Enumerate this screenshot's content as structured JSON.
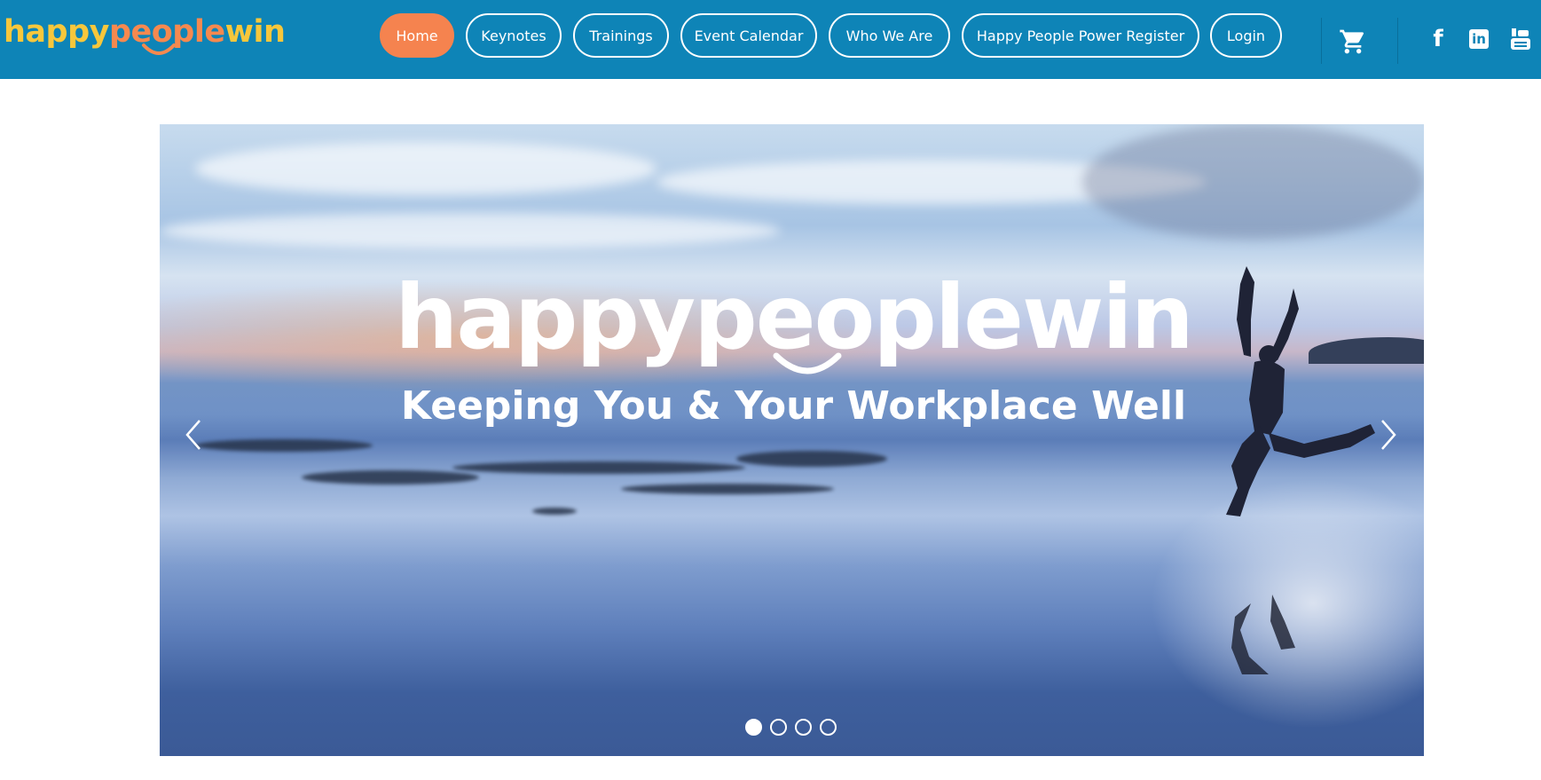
{
  "brand": {
    "logo_part1": "happy",
    "logo_part2": "people",
    "logo_part3": "win",
    "logo_color_yellow": "#f7c73c",
    "logo_color_orange": "#f5894f"
  },
  "colors": {
    "header_bg": "#0e84b7",
    "active_nav_bg": "#f5834f"
  },
  "nav": {
    "items": [
      {
        "label": "Home",
        "active": true
      },
      {
        "label": "Keynotes",
        "active": false
      },
      {
        "label": "Trainings",
        "active": false
      },
      {
        "label": "Event Calendar",
        "active": false
      },
      {
        "label": "Who We Are",
        "active": false
      },
      {
        "label": "Happy People Power Register",
        "active": false
      },
      {
        "label": "Login",
        "active": false
      }
    ]
  },
  "header_icons": {
    "cart": "cart-icon",
    "facebook": "f",
    "linkedin": "in",
    "youtube": "youtube-icon"
  },
  "hero": {
    "title": "happypeoplewin",
    "tagline": "Keeping You & Your Workplace Well",
    "prev_icon": "chevron-left-icon",
    "next_icon": "chevron-right-icon",
    "slide_count": 4,
    "active_slide": 1
  }
}
